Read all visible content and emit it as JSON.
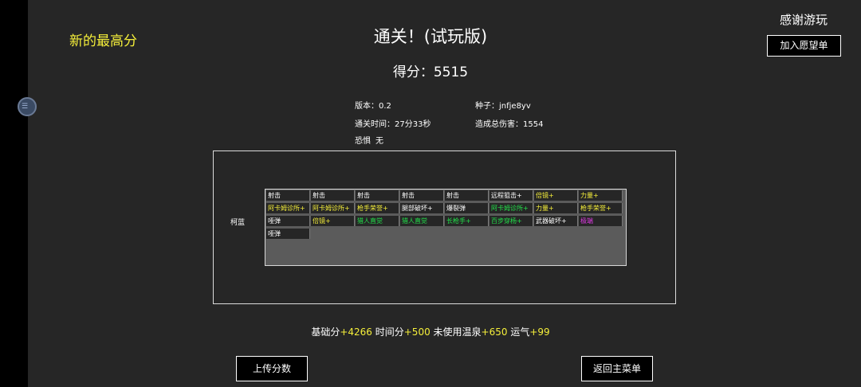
{
  "header": {
    "new_high": "新的最高分",
    "title": "通关！(试玩版)",
    "score_label": "得分：",
    "score_value": "5515",
    "thanks": "感谢游玩",
    "wishlist": "加入愿望单"
  },
  "info": {
    "version_label": "版本：",
    "version": "0.2",
    "seed_label": "种子：",
    "seed": "jnfje8yv",
    "time_label": "通关时间：",
    "time": "27分33秒",
    "damage_label": "造成总伤害：",
    "damage": "1554",
    "fear_label": "恐惧",
    "fear": "无"
  },
  "character": {
    "name": "柯蓝"
  },
  "colors": {
    "white": "#ffffff",
    "yellow": "#f5ef3a",
    "green": "#22e04a",
    "magenta": "#e23ae8"
  },
  "upgrades": [
    [
      {
        "text": "射击",
        "color": "white"
      },
      {
        "text": "射击",
        "color": "white"
      },
      {
        "text": "射击",
        "color": "white"
      },
      {
        "text": "射击",
        "color": "white"
      },
      {
        "text": "射击",
        "color": "white"
      },
      {
        "text": "远程狙击+",
        "color": "white"
      },
      {
        "text": "倍镜+",
        "color": "yellow"
      },
      {
        "text": "力量+",
        "color": "yellow"
      }
    ],
    [
      {
        "text": "阿卡姆诊所+",
        "color": "yellow"
      },
      {
        "text": "阿卡姆诊所+",
        "color": "yellow"
      },
      {
        "text": "枪手荣誉+",
        "color": "yellow"
      },
      {
        "text": "腿部破坏+",
        "color": "white"
      },
      {
        "text": "爆裂弹",
        "color": "white"
      },
      {
        "text": "阿卡姆诊所+",
        "color": "green"
      },
      {
        "text": "力量+",
        "color": "yellow"
      },
      {
        "text": "枪手荣誉+",
        "color": "yellow"
      }
    ],
    [
      {
        "text": "哑弹",
        "color": "white"
      },
      {
        "text": "倍镜+",
        "color": "yellow"
      },
      {
        "text": "猎人直觉",
        "color": "green"
      },
      {
        "text": "猎人直觉",
        "color": "green"
      },
      {
        "text": "长枪手+",
        "color": "green"
      },
      {
        "text": "百步穿杨+",
        "color": "green"
      },
      {
        "text": "武器破坏+",
        "color": "white"
      },
      {
        "text": "极端",
        "color": "magenta"
      }
    ],
    [
      {
        "text": "哑弹",
        "color": "white"
      }
    ]
  ],
  "summary": {
    "base_label": "基础分",
    "base": "+4266",
    "time_label": " 时间分",
    "time": "+500",
    "spring_label": " 未使用温泉",
    "spring": "+650",
    "luck_label": " 运气",
    "luck": "+99"
  },
  "buttons": {
    "upload": "上传分数",
    "main_menu": "返回主菜单"
  }
}
